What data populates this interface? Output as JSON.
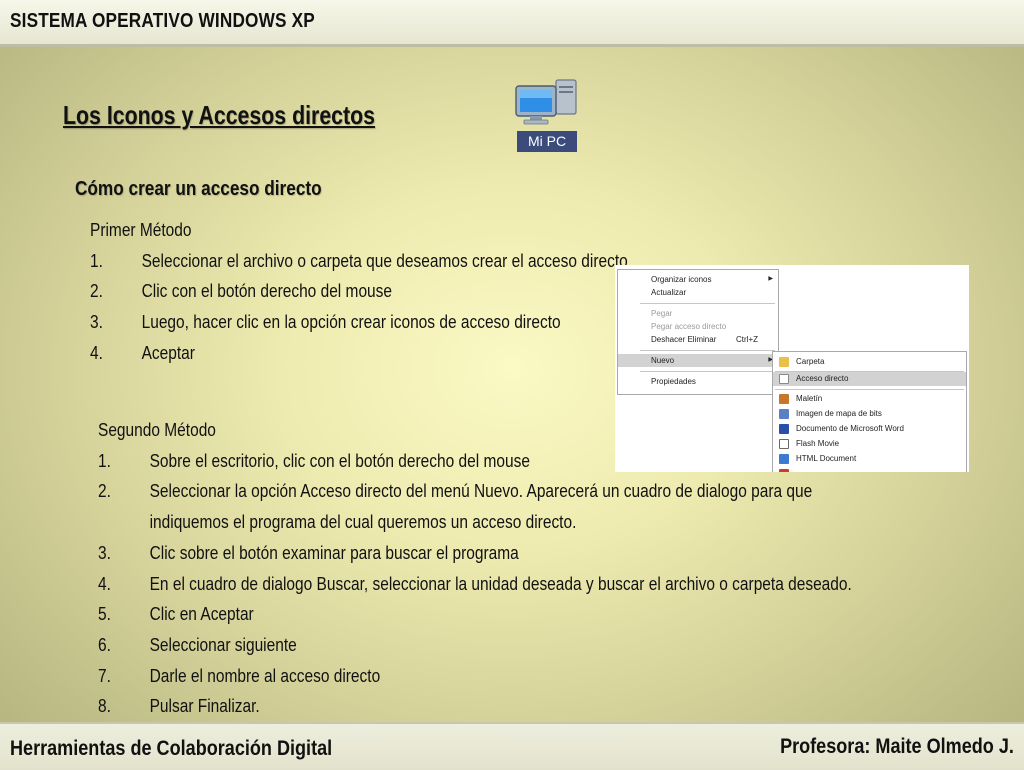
{
  "header": {
    "title": "SISTEMA OPERATIVO WINDOWS XP"
  },
  "heading": "Los Iconos y Accesos directos",
  "subheading": "Cómo crear un acceso directo",
  "desktop_icon": {
    "label": "Mi PC",
    "icon": "my-computer-icon"
  },
  "method1": {
    "title": "Primer Método",
    "steps": [
      {
        "num": "1.",
        "text": "Seleccionar el archivo o carpeta que deseamos crear el acceso directo"
      },
      {
        "num": "2.",
        "text": "Clic con el botón derecho del mouse"
      },
      {
        "num": "3.",
        "text": "Luego, hacer clic en la opción crear iconos de acceso directo"
      },
      {
        "num": "4.",
        "text": "Aceptar"
      }
    ]
  },
  "method2": {
    "title": "Segundo Método",
    "steps": [
      {
        "num": "1.",
        "text": "Sobre el escritorio, clic con el botón derecho del mouse"
      },
      {
        "num": "2.",
        "text": "Seleccionar la opción Acceso directo del menú Nuevo.  Aparecerá un cuadro de dialogo para que"
      },
      {
        "num": "",
        "text": "indiquemos el programa del cual queremos un acceso directo."
      },
      {
        "num": "3.",
        "text": "Clic sobre el botón examinar para buscar el programa"
      },
      {
        "num": "4.",
        "text": "En el cuadro de dialogo Buscar, seleccionar la unidad deseada y buscar el archivo o carpeta deseado."
      },
      {
        "num": "5.",
        "text": "Clic en Aceptar"
      },
      {
        "num": "6.",
        "text": "Seleccionar siguiente"
      },
      {
        "num": "7.",
        "text": "Darle el nombre al acceso directo"
      },
      {
        "num": "8.",
        "text": "Pulsar Finalizar."
      }
    ]
  },
  "context_menu": {
    "items": [
      {
        "label": "Organizar iconos",
        "submenu": true
      },
      {
        "label": "Actualizar"
      },
      {
        "label": "Pegar",
        "disabled": true
      },
      {
        "label": "Pegar acceso directo",
        "disabled": true
      },
      {
        "label": "Deshacer Eliminar",
        "shortcut": "Ctrl+Z"
      },
      {
        "label": "Nuevo",
        "submenu": true,
        "highlighted": true
      },
      {
        "label": "Propiedades"
      }
    ]
  },
  "submenu_nuevo": {
    "items": [
      {
        "label": "Carpeta",
        "icon": "folder-icon",
        "color": "#e8c04a"
      },
      {
        "label": "Acceso directo",
        "icon": "shortcut-icon",
        "color": "#8a8a8a",
        "highlighted": true
      },
      {
        "label": "Maletín",
        "icon": "briefcase-icon",
        "color": "#c8742a"
      },
      {
        "label": "Imagen de mapa de bits",
        "icon": "bitmap-icon",
        "color": "#5a7fc4"
      },
      {
        "label": "Documento de Microsoft Word",
        "icon": "word-document-icon",
        "color": "#2a4fa8"
      },
      {
        "label": "Flash Movie",
        "icon": "flash-movie-icon",
        "color": "#6a6a6a"
      },
      {
        "label": "HTML Document",
        "icon": "html-document-icon",
        "color": "#3a7ad0"
      },
      {
        "label": "",
        "icon": "document-icon",
        "color": "#d03a2a"
      }
    ]
  },
  "footer": {
    "course": "Herramientas de Colaboración Digital",
    "teacher": "Profesora: Maite Olmedo J."
  }
}
